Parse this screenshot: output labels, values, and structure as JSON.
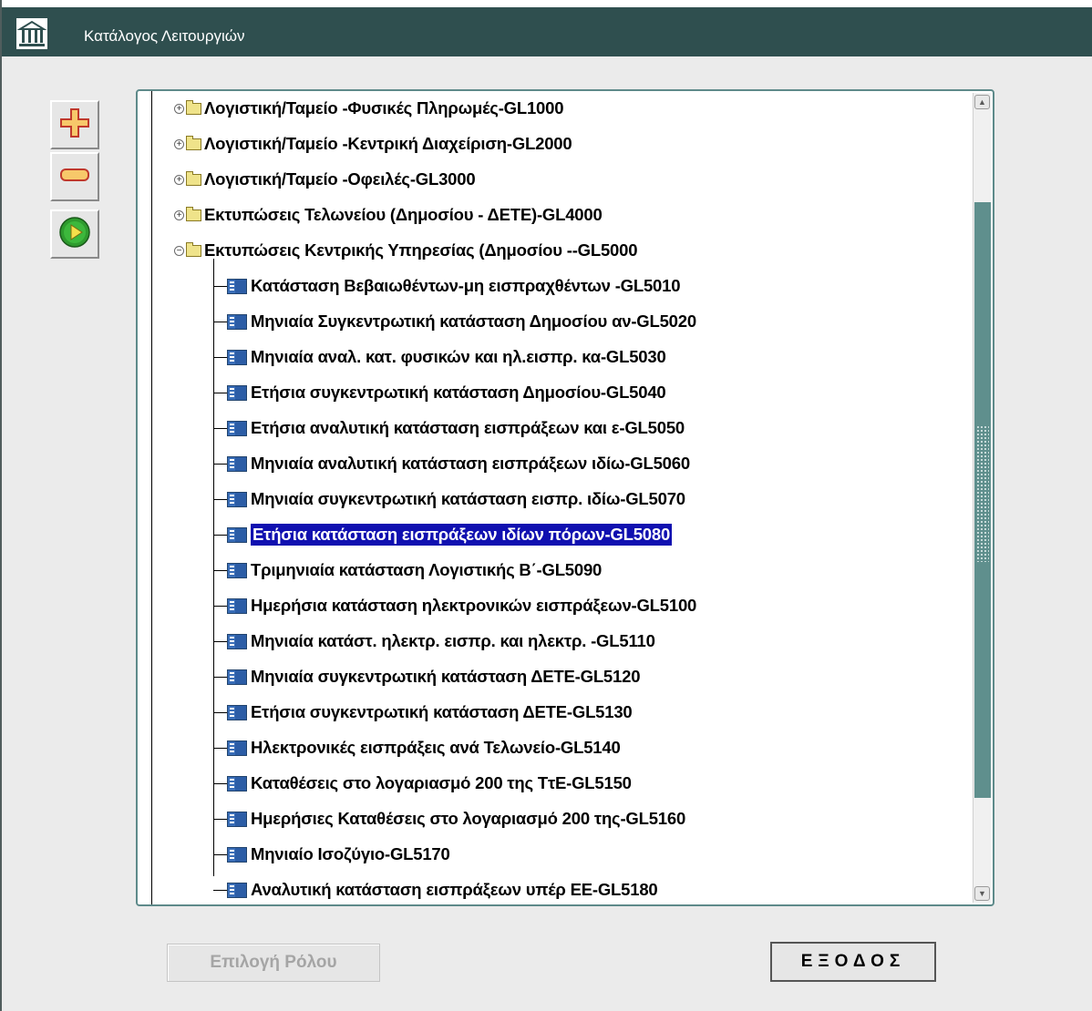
{
  "window": {
    "title": "Κατάλογος Λειτουργιών",
    "title_bar_color": "#2f4f4f",
    "app_icon": "building-icon"
  },
  "toolbar": [
    {
      "name": "expand",
      "icon": "plus-icon"
    },
    {
      "name": "collapse",
      "icon": "minus-icon"
    },
    {
      "name": "run",
      "icon": "play-icon"
    }
  ],
  "tree": {
    "folders": [
      {
        "label": "Λογιστική/Ταμείο -Φυσικές Πληρωμές-GL1000",
        "expanded": false
      },
      {
        "label": "Λογιστική/Ταμείο -Κεντρική Διαχείριση-GL2000",
        "expanded": false
      },
      {
        "label": "Λογιστική/Ταμείο -Οφειλές-GL3000",
        "expanded": false
      },
      {
        "label": "Εκτυπώσεις  Τελωνείου (Δημοσίου - ΔΕΤΕ)-GL4000",
        "expanded": false
      },
      {
        "label": "Εκτυπώσεις  Κεντρικής Υπηρεσίας (Δημοσίου --GL5000",
        "expanded": true
      }
    ],
    "items": [
      {
        "label": "Κατάσταση Βεβαιωθέντων-μη εισπραχθέντων -GL5010"
      },
      {
        "label": "Μηνιαία Συγκεντρωτική κατάσταση Δημοσίου αν-GL5020"
      },
      {
        "label": "Μηνιαία αναλ. κατ. φυσικών και ηλ.εισπρ. κα-GL5030"
      },
      {
        "label": "Ετήσια συγκεντρωτική κατάσταση Δημοσίου-GL5040"
      },
      {
        "label": "Ετήσια αναλυτική κατάσταση εισπράξεων και ε-GL5050"
      },
      {
        "label": "Μηνιαία αναλυτική κατάσταση εισπράξεων ιδίω-GL5060"
      },
      {
        "label": "Μηνιαία συγκεντρωτική κατάσταση εισπρ. ιδίω-GL5070"
      },
      {
        "label": "Ετήσια κατάσταση εισπράξεων ιδίων πόρων-GL5080",
        "selected": true
      },
      {
        "label": "Τριμηνιαία κατάσταση Λογιστικής Β΄-GL5090"
      },
      {
        "label": "Ημερήσια κατάσταση ηλεκτρονικών εισπράξεων-GL5100"
      },
      {
        "label": "Μηνιαία κατάστ. ηλεκτρ. εισπρ. και ηλεκτρ. -GL5110"
      },
      {
        "label": "Μηνιαία συγκεντρωτική κατάσταση ΔΕΤΕ-GL5120"
      },
      {
        "label": "Ετήσια συγκεντρωτική κατάσταση ΔΕΤΕ-GL5130"
      },
      {
        "label": "Ηλεκτρονικές εισπράξεις ανά Τελωνείο-GL5140"
      },
      {
        "label": "Καταθέσεις στο λογαριασμό 200 της ΤτΕ-GL5150"
      },
      {
        "label": "Ημερήσιες Καταθέσεις στο λογαριασμό 200 της-GL5160"
      },
      {
        "label": "Μηνιαίο Ισοζύγιο-GL5170"
      },
      {
        "label": "Αναλυτική κατάσταση εισπράξεων υπέρ ΕΕ-GL5180"
      }
    ],
    "selection_color": "#1010b0"
  },
  "buttons": {
    "role_label": "Επιλογή Ρόλου",
    "role_enabled": false,
    "exit_label": "ΕΞΟΔΟΣ"
  }
}
